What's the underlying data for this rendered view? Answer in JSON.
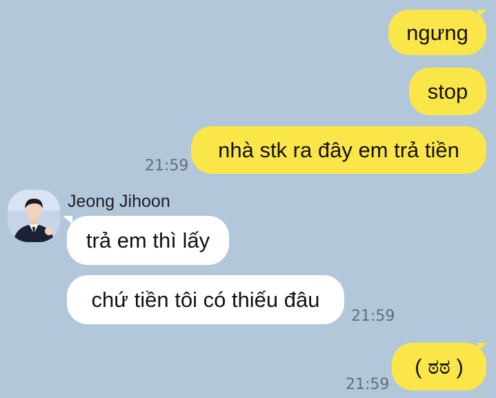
{
  "chat": {
    "outgoing_1": "ngưng",
    "outgoing_2": "stop",
    "outgoing_3": "nhà stk ra đây em trả tiền",
    "time_1": "21:59",
    "sender_name": "Jeong Jihoon",
    "incoming_1": "trả em thì lấy",
    "incoming_2": "chứ tiền tôi có thiếu đâu",
    "time_2": "21:59",
    "outgoing_4": "( ಠಠ )",
    "time_3": "21:59"
  },
  "colors": {
    "background": "#b2c7da",
    "outgoing_bubble": "#fbe64a",
    "incoming_bubble": "#ffffff"
  },
  "icons": {
    "avatar": "person-photo-avatar"
  }
}
